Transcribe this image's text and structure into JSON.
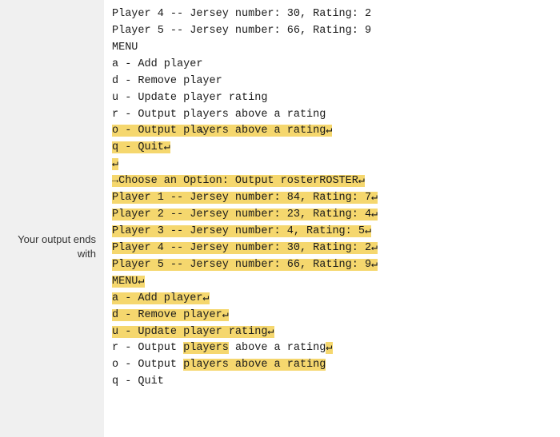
{
  "sidebar": {
    "label_line1": "Your output ends",
    "label_line2": "with"
  },
  "terminal": {
    "top_lines": [
      "Player 4 -- Jersey number: 30, Rating: 2",
      "Player 5 -- Jersey number: 66, Rating: 9"
    ],
    "menu_header": "MENU",
    "menu_items": [
      "a - Add player",
      "d - Remove player",
      "u - Update player rating",
      "r - Output players above a rating",
      "o - Output players above a rating",
      "q - Quit"
    ],
    "prompt_line": "→Choose an Option: Output rosterROSTER↵",
    "roster_lines": [
      "Player 1 -- Jersey number: 84, Rating: 7↵",
      "Player 2 -- Jersey number: 23, Rating: 4↵",
      "Player 3 -- Jersey number: 4, Rating: 5↵",
      "Player 4 -- Jersey number: 30, Rating: 2↵",
      "Player 5 -- Jersey number: 66, Rating: 9↵"
    ],
    "menu_header2": "MENU↵",
    "menu_items2": [
      "a - Add player↵",
      "d - Remove player↵",
      "u - Update player rating↵",
      "r - Output players above a rating↵",
      "o - Output players above a rating",
      "q - Quit"
    ]
  }
}
